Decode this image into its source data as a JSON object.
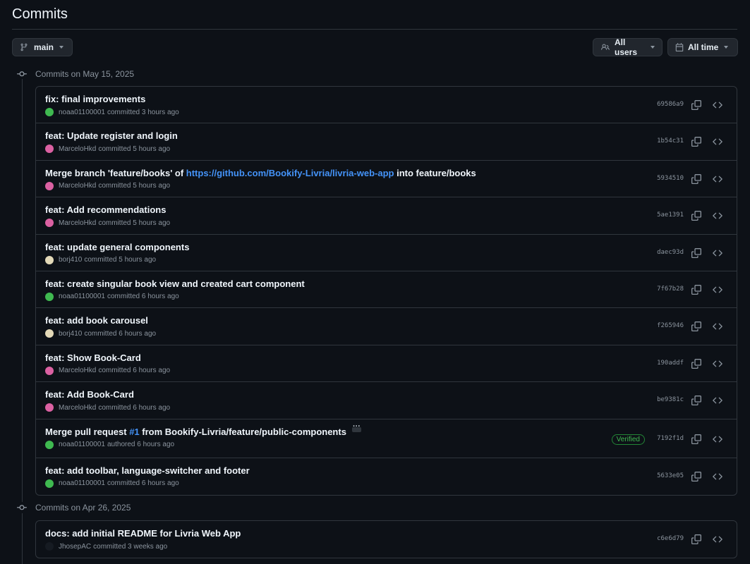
{
  "page": {
    "title": "Commits"
  },
  "toolbar": {
    "branch_label": "main",
    "users_label": "All users",
    "time_label": "All time"
  },
  "groups": [
    {
      "header": "Commits on May 15, 2025",
      "commits": [
        {
          "message": "fix: final improvements",
          "author": "noaa01100001",
          "action": "committed 3 hours ago",
          "sha": "69586a9",
          "avatar_color": "#3fb950"
        },
        {
          "message": "feat: Update register and login",
          "author": "MarceloHkd",
          "action": "committed 5 hours ago",
          "sha": "1b54c31",
          "avatar_color": "#db61a2"
        },
        {
          "message_pre": "Merge branch 'feature/books' of ",
          "message_link": "https://github.com/Bookify-Livria/livria-web-app",
          "message_post": " into feature/books",
          "author": "MarceloHkd",
          "action": "committed 5 hours ago",
          "sha": "5934510",
          "avatar_color": "#db61a2"
        },
        {
          "message": "feat: Add recommendations",
          "author": "MarceloHkd",
          "action": "committed 5 hours ago",
          "sha": "5ae1391",
          "avatar_color": "#db61a2"
        },
        {
          "message": "feat: update general components",
          "author": "borj410",
          "action": "committed 5 hours ago",
          "sha": "daec93d",
          "avatar_color": "#e3d9b8"
        },
        {
          "message": "feat: create singular book view and created cart component",
          "author": "noaa01100001",
          "action": "committed 6 hours ago",
          "sha": "7f67b28",
          "avatar_color": "#3fb950"
        },
        {
          "message": "feat: add book carousel",
          "author": "borj410",
          "action": "committed 6 hours ago",
          "sha": "f265946",
          "avatar_color": "#e3d9b8"
        },
        {
          "message": "feat: Show Book-Card",
          "author": "MarceloHkd",
          "action": "committed 6 hours ago",
          "sha": "190addf",
          "avatar_color": "#db61a2"
        },
        {
          "message": "feat: Add Book-Card",
          "author": "MarceloHkd",
          "action": "committed 6 hours ago",
          "sha": "be9381c",
          "avatar_color": "#db61a2"
        },
        {
          "message_pre": "Merge pull request ",
          "message_link": "#1",
          "message_post": " from Bookify-Livria/feature/public-components",
          "author": "noaa01100001",
          "action": "authored 6 hours ago",
          "sha": "7192f1d",
          "badge": "Verified",
          "avatar_color": "#3fb950"
        },
        {
          "message": "feat: add toolbar, language-switcher and footer",
          "author": "noaa01100001",
          "action": "committed 6 hours ago",
          "sha": "5633e05",
          "avatar_color": "#3fb950"
        }
      ]
    },
    {
      "header": "Commits on Apr 26, 2025",
      "commits": [
        {
          "message": "docs: add initial README for Livria Web App",
          "author": "JhosepAC",
          "action": "committed 3 weeks ago",
          "sha": "c6e6d79",
          "avatar_color": "#161b22"
        }
      ]
    }
  ]
}
